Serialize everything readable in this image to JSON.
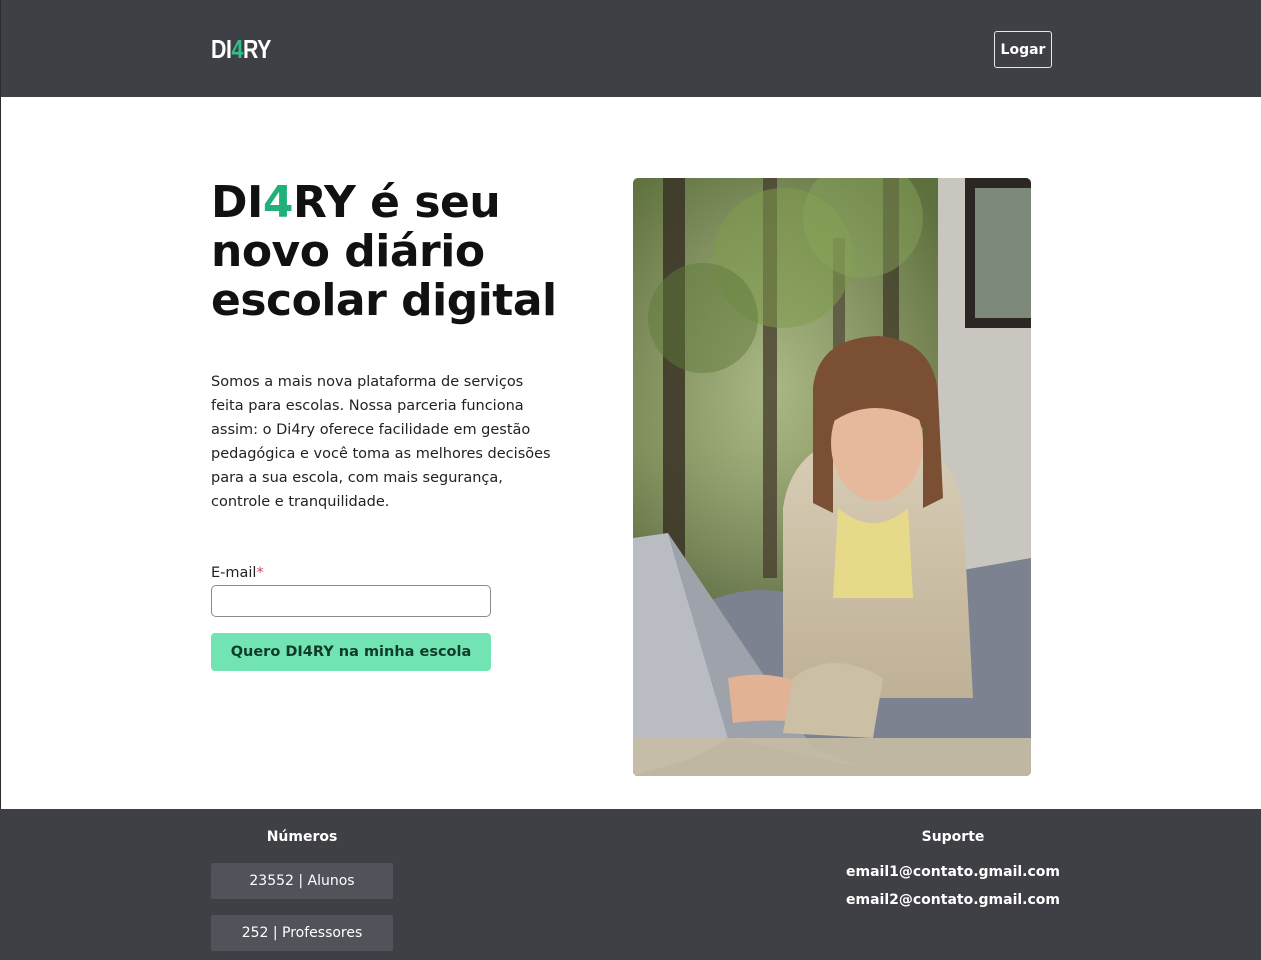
{
  "header": {
    "logo": {
      "prefix": "DI",
      "accent": "4",
      "suffix": "RY"
    },
    "login_label": "Logar"
  },
  "hero": {
    "headline": {
      "prefix": "DI",
      "accent": "4",
      "rest_line1": "RY é seu",
      "line2": "novo diário",
      "line3": "escolar digital"
    },
    "description": "Somos a mais nova plataforma de serviços feita para escolas. Nossa parceria funciona assim: o Di4ry oferece facilidade em gestão pedagógica e você toma as melhores decisões para a sua escola, com mais segurança, controle e tranquilidade.",
    "form": {
      "email_label": "E-mail",
      "required_mark": "*",
      "email_value": "",
      "submit_label": "Quero DI4RY na minha escola"
    }
  },
  "footer": {
    "numbers": {
      "heading": "Números",
      "stats": [
        {
          "label": "23552 | Alunos"
        },
        {
          "label": "252 | Professores"
        }
      ]
    },
    "support": {
      "heading": "Suporte",
      "emails": [
        "email1@contato.gmail.com",
        "email2@contato.gmail.com"
      ]
    }
  },
  "colors": {
    "bar_background": "#3f3f46",
    "accent": "#22b07a",
    "cta_background": "#72e4b4",
    "stat_card": "#52525b"
  }
}
